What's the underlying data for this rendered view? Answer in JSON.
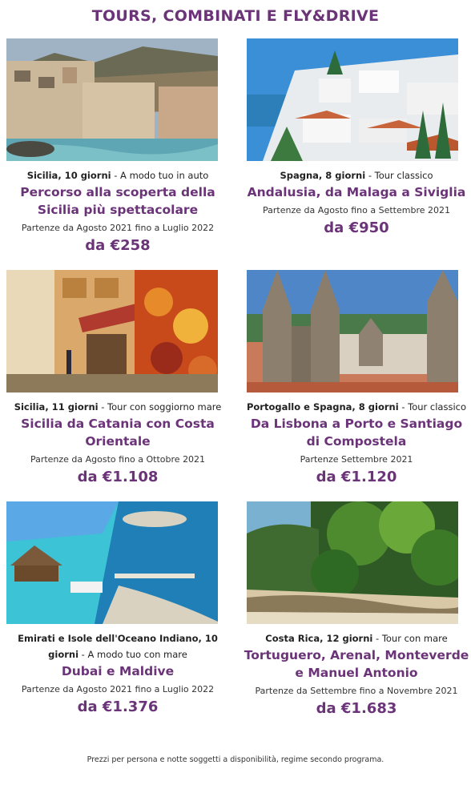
{
  "title": "TOURS, COMBINATI E FLY&DRIVE",
  "cards": [
    {
      "region": "Sicilia, 10 giorni",
      "kind": "A modo tuo in auto",
      "name": "Percorso alla scoperta della Sicilia più spettacolare",
      "dates": "Partenze da Agosto 2021 fino a Luglio 2022",
      "price": "da €258",
      "image": "cefalu-coast-photo"
    },
    {
      "region": "Spagna, 8 giorni",
      "kind": "Tour classico",
      "name": "Andalusia, da Malaga a Siviglia",
      "dates": "Partenze da Agosto fino a Settembre 2021",
      "price": "da €950",
      "image": "andalusia-white-village-photo"
    },
    {
      "region": "Sicilia, 11 giorni",
      "kind": "Tour con soggiorno mare",
      "name": "Sicilia da Catania con Costa Orientale",
      "dates": "Partenze da Agosto fino a Ottobre 2021",
      "price": "da €1.108",
      "image": "sicilian-street-photo"
    },
    {
      "region": "Portogallo e Spagna, 8 giorni",
      "kind": "Tour classico",
      "name": "Da Lisbona a Porto e Santiago di Compostela",
      "dates": "Partenze Settembre 2021",
      "price": "da €1.120",
      "image": "santiago-cathedral-photo"
    },
    {
      "region": "Emirati e Isole dell'Oceano Indiano, 10 giorni",
      "kind": "A modo tuo con mare",
      "name": "Dubai e Maldive",
      "dates": "Partenze da Agosto 2021 fino a Luglio 2022",
      "price": "da €1.376",
      "image": "dubai-maldives-photo"
    },
    {
      "region": "Costa Rica, 12 giorni",
      "kind": "Tour con mare",
      "name": "Tortuguero, Arenal, Monteverde e Manuel Antonio",
      "dates": "Partenze da Settembre fino a Novembre 2021",
      "price": "da €1.683",
      "image": "costa-rica-beach-photo"
    }
  ],
  "footer": "Prezzi per persona e notte soggetti a disponibilità, regime secondo programa.",
  "colors": {
    "accent": "#6b3478"
  }
}
